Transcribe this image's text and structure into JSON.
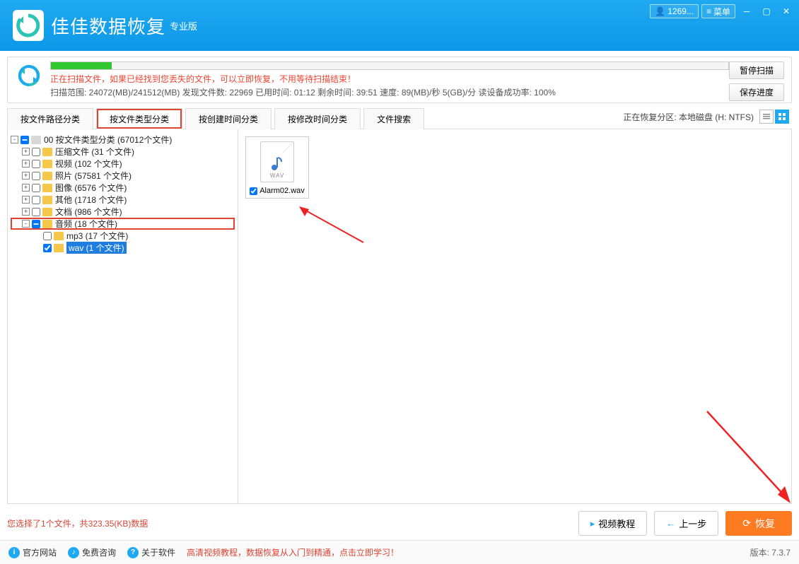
{
  "titlebar": {
    "user_label": "1269...",
    "menu_label": "菜单"
  },
  "app": {
    "title": "佳佳数据恢复",
    "subtitle": "专业版"
  },
  "scan": {
    "progress_percent": 9,
    "message": "正在扫描文件，如果已经找到您丢失的文件，可以立即恢复，不用等待扫描结束！",
    "stats": "扫描范围: 24072(MB)/241512(MB)    发现文件数: 22969    已用时间: 01:12    剩余时间: 39:51    速度: 89(MB)/秒  5(GB)/分  读设备成功率: 100%",
    "pause_label": "暂停扫描",
    "save_label": "保存进度"
  },
  "tabs": {
    "items": [
      "按文件路径分类",
      "按文件类型分类",
      "按创建时间分类",
      "按修改时间分类",
      "文件搜索"
    ],
    "active_index": 1,
    "highlighted_index": 1,
    "right_info": "正在恢复分区: 本地磁盘 (H: NTFS)"
  },
  "tree": [
    {
      "indent": 0,
      "toggle": "-",
      "checked": "partial",
      "icon": "root",
      "label": "00 按文件类型分类    (67012个文件)"
    },
    {
      "indent": 1,
      "toggle": "+",
      "checked": false,
      "icon": "folder",
      "label": "压缩文件    (31 个文件)"
    },
    {
      "indent": 1,
      "toggle": "+",
      "checked": false,
      "icon": "folder",
      "label": "视频    (102 个文件)"
    },
    {
      "indent": 1,
      "toggle": "+",
      "checked": false,
      "icon": "folder",
      "label": "照片    (57581 个文件)"
    },
    {
      "indent": 1,
      "toggle": "+",
      "checked": false,
      "icon": "folder",
      "label": "图像    (6576 个文件)"
    },
    {
      "indent": 1,
      "toggle": "+",
      "checked": false,
      "icon": "folder",
      "label": "其他    (1718 个文件)"
    },
    {
      "indent": 1,
      "toggle": "+",
      "checked": false,
      "icon": "folder",
      "label": "文档    (986 个文件)"
    },
    {
      "indent": 1,
      "toggle": "-",
      "checked": "partial",
      "icon": "folder",
      "label": "音频    (18 个文件)",
      "highlighted": true
    },
    {
      "indent": 2,
      "toggle": "",
      "checked": false,
      "icon": "folder",
      "label": "mp3    (17 个文件)"
    },
    {
      "indent": 2,
      "toggle": "",
      "checked": true,
      "icon": "folder",
      "label": "wav    (1 个文件)",
      "selected": true
    }
  ],
  "file": {
    "ext": "WAV",
    "name": "Alarm02.wav",
    "checked": true
  },
  "footer": {
    "selection_info": "您选择了1个文件，共323.35(KB)数据",
    "video_label": "视频教程",
    "prev_label": "上一步",
    "recover_label": "恢复"
  },
  "bottombar": {
    "link1": "官方网站",
    "link2": "免费咨询",
    "link3": "关于软件",
    "promo": "高清视频教程，数据恢复从入门到精通，点击立即学习！",
    "version": "版本: 7.3.7"
  }
}
